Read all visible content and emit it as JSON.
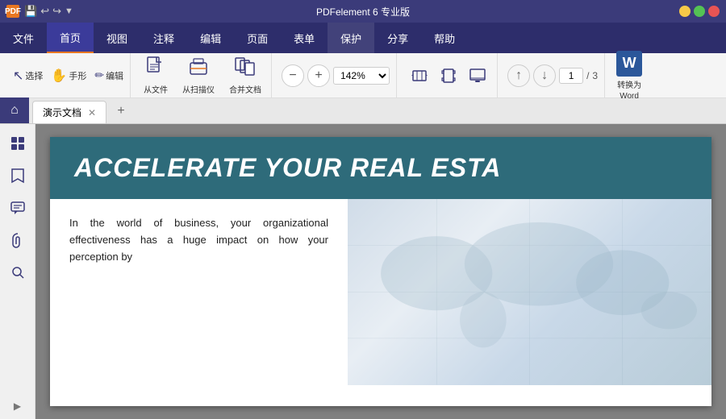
{
  "app": {
    "title": "PDFelement 6 专业版",
    "icon_label": "PDF"
  },
  "titlebar": {
    "quick_access": [
      "💾",
      "↩",
      "↪",
      "▼"
    ]
  },
  "menubar": {
    "items": [
      {
        "id": "file",
        "label": "文件"
      },
      {
        "id": "home",
        "label": "首页",
        "active": true
      },
      {
        "id": "view",
        "label": "视图"
      },
      {
        "id": "comment",
        "label": "注释"
      },
      {
        "id": "edit",
        "label": "编辑"
      },
      {
        "id": "page",
        "label": "页面"
      },
      {
        "id": "form",
        "label": "表单"
      },
      {
        "id": "protect",
        "label": "保护",
        "highlighted": true
      },
      {
        "id": "share",
        "label": "分享"
      },
      {
        "id": "help",
        "label": "帮助"
      }
    ]
  },
  "toolbar": {
    "tools": [
      {
        "id": "select",
        "icon": "↖",
        "label": "选择"
      },
      {
        "id": "handtool",
        "icon": "✋",
        "label": "手形"
      },
      {
        "id": "edit",
        "icon": "✏",
        "label": "编辑"
      }
    ],
    "create": [
      {
        "id": "from-file",
        "icon": "📄",
        "label": "从文件"
      },
      {
        "id": "from-scanner",
        "icon": "🖨",
        "label": "从扫描仪"
      },
      {
        "id": "merge",
        "icon": "📑",
        "label": "合并文档"
      }
    ],
    "zoom": {
      "minus_label": "−",
      "plus_label": "+",
      "value": "142%"
    },
    "view_buttons": [
      "⊞",
      "⤢",
      "🖥"
    ],
    "page_nav": {
      "up_arrow": "↑",
      "down_arrow": "↓",
      "current": "1",
      "separator": "/",
      "total": "3"
    },
    "convert": {
      "icon": "W",
      "line1": "转换为",
      "line2": "Word"
    }
  },
  "tabs": {
    "home_icon": "⌂",
    "items": [
      {
        "label": "演示文档",
        "active": true
      }
    ],
    "add_icon": "+"
  },
  "sidebar": {
    "buttons": [
      "☰",
      "🔖",
      "💬",
      "📎",
      "🔍"
    ],
    "expand_icon": "▶"
  },
  "pdf": {
    "banner_text": "ACCELERATE YOUR REAL ESTA",
    "body_text": "In the world of business, your organizational effectiveness has a huge impact on how your perception by"
  }
}
